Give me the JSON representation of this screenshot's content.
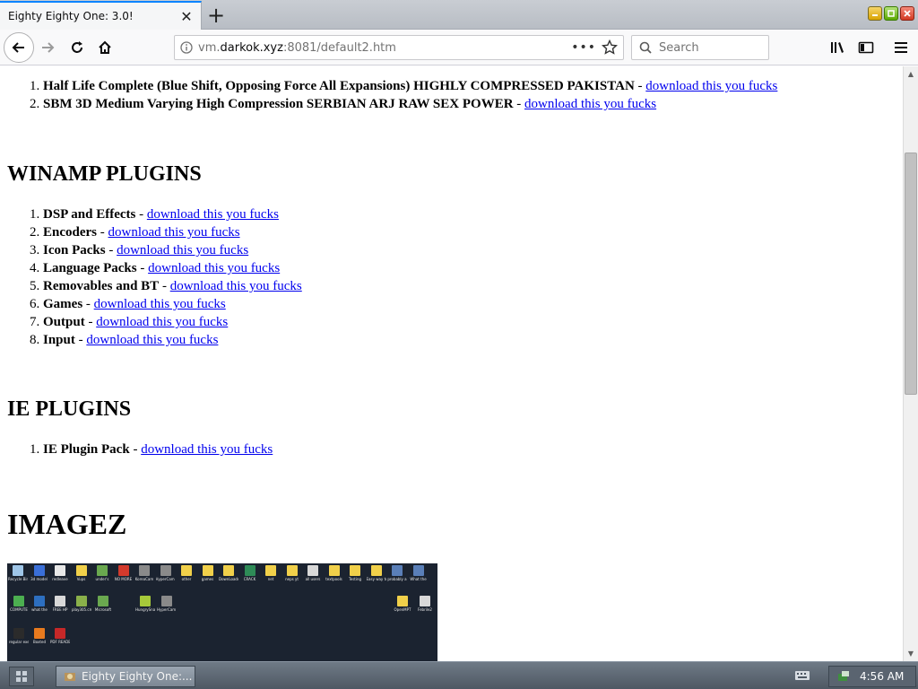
{
  "tab": {
    "title": "Eighty Eighty One: 3.0!"
  },
  "nav": {
    "url_prefix": "vm.",
    "url_host": "darkok.xyz",
    "url_rest": ":8081/default2.htm",
    "search_placeholder": "Search"
  },
  "page": {
    "top_list": [
      {
        "num": "1.",
        "title": "Half Life Complete (Blue Shift, Opposing Force All Expansions) HIGHLY COMPRESSED PAKISTAN",
        "sep": " - ",
        "link": "download this you fucks"
      },
      {
        "num": "2.",
        "title": "SBM 3D Medium Varying High Compression SERBIAN ARJ RAW SEX POWER",
        "sep": " - ",
        "link": "download this you fucks"
      }
    ],
    "winamp": {
      "heading": "WINAMP PLUGINS",
      "items": [
        {
          "title": "DSP and Effects",
          "sep": " - ",
          "link": "download this you fucks"
        },
        {
          "title": "Encoders",
          "sep": " - ",
          "link": "download this you fucks"
        },
        {
          "title": "Icon Packs",
          "sep": " - ",
          "link": "download this you fucks"
        },
        {
          "title": "Language Packs",
          "sep": " - ",
          "link": "download this you fucks"
        },
        {
          "title": "Removables and BT",
          "sep": " - ",
          "link": "download this you fucks"
        },
        {
          "title": "Games",
          "sep": " - ",
          "link": "download this you fucks"
        },
        {
          "title": "Output",
          "sep": " - ",
          "link": "download this you fucks"
        },
        {
          "title": "Input",
          "sep": " - ",
          "link": "download this you fucks"
        }
      ]
    },
    "ie": {
      "heading": "IE PLUGINS",
      "items": [
        {
          "title": "IE Plugin Pack",
          "sep": " - ",
          "link": "download this you fucks"
        }
      ]
    },
    "imagez": {
      "heading": "IMAGEZ",
      "desktop_icons": [
        {
          "label": "Recycle Bin",
          "color": "#9fc6e8"
        },
        {
          "label": "3d model",
          "color": "#3a6fd8"
        },
        {
          "label": "redleave",
          "color": "#e8e8e8"
        },
        {
          "label": "Vups",
          "color": "#f1d04a"
        },
        {
          "label": "under's",
          "color": "#6aa84f"
        },
        {
          "label": "NO MORE",
          "color": "#d33a2c"
        },
        {
          "label": "KoreaCam",
          "color": "#8a8a8a"
        },
        {
          "label": "HyperCam 1",
          "color": "#8a8a8a"
        },
        {
          "label": "other",
          "color": "#f1d04a"
        },
        {
          "label": "games",
          "color": "#f1d04a"
        },
        {
          "label": "DownLoads",
          "color": "#f1d04a"
        },
        {
          "label": "CRACK",
          "color": "#2e8b57"
        },
        {
          "label": "net",
          "color": "#f1d04a"
        },
        {
          "label": "neps yt",
          "color": "#f1d04a"
        },
        {
          "label": "all users",
          "color": "#d8d8d8"
        },
        {
          "label": "textpools",
          "color": "#f1d04a"
        },
        {
          "label": "Testing",
          "color": "#f1d04a"
        },
        {
          "label": "Easy way to",
          "color": "#f1d04a"
        },
        {
          "label": "probably a",
          "color": "#5a7fb8"
        },
        {
          "label": "What the",
          "color": "#5a7fb8"
        },
        {
          "label": "COMPUTE",
          "color": "#4caf50"
        },
        {
          "label": "what the",
          "color": "#2d6fc0"
        },
        {
          "label": "FREE HP",
          "color": "#d8d8d8"
        },
        {
          "label": "play305.cmd",
          "color": "#8ab04a"
        },
        {
          "label": "Microsoft",
          "color": "#6aa84f"
        },
        {
          "label": "HungrySnap",
          "color": "#a6c93a"
        },
        {
          "label": "HyperCam 2",
          "color": "#8a8a8a"
        },
        {
          "label": "OpenMPT",
          "color": "#f1d04a"
        },
        {
          "label": "Febrile2",
          "color": "#d8d8d8"
        },
        {
          "label": "regular exe",
          "color": "#2b2b2b"
        },
        {
          "label": "Boxted",
          "color": "#e87a1e"
        },
        {
          "label": "PDF READER",
          "color": "#c62828"
        }
      ]
    }
  },
  "taskbar": {
    "task_label": "Eighty Eighty One:...",
    "clock": "4:56 AM"
  }
}
